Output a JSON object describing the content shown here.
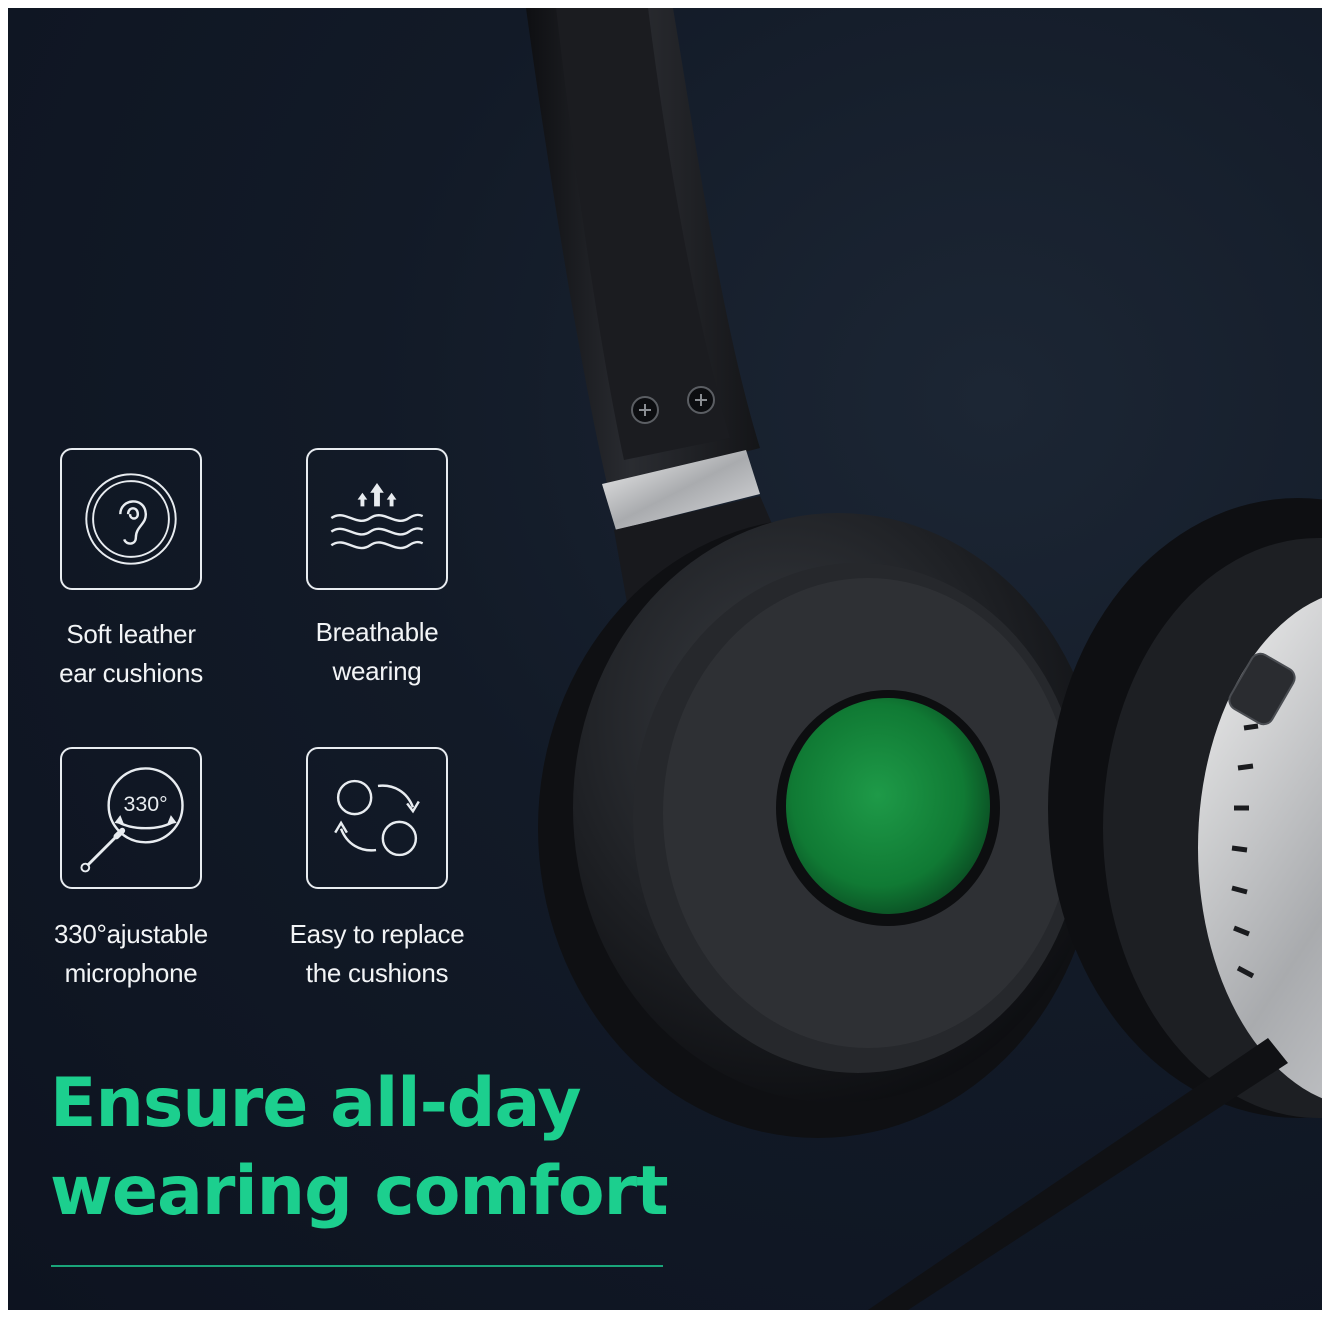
{
  "features": [
    {
      "icon": "ear-icon",
      "line1": "Soft leather",
      "line2": "ear cushions"
    },
    {
      "icon": "breathable-airflow-icon",
      "line1": "Breathable",
      "line2": "wearing"
    },
    {
      "icon": "rotating-microphone-icon",
      "badge": "330°",
      "line1": "330°ajustable",
      "line2": "microphone"
    },
    {
      "icon": "swap-cushions-icon",
      "line1": "Easy to replace",
      "line2": "the cushions"
    }
  ],
  "headline": {
    "line1": "Ensure all-day",
    "line2": "wearing comfort"
  },
  "colors": {
    "background": "#0f1624",
    "accent": "#1ccf8e",
    "text": "#f2f4f6"
  }
}
